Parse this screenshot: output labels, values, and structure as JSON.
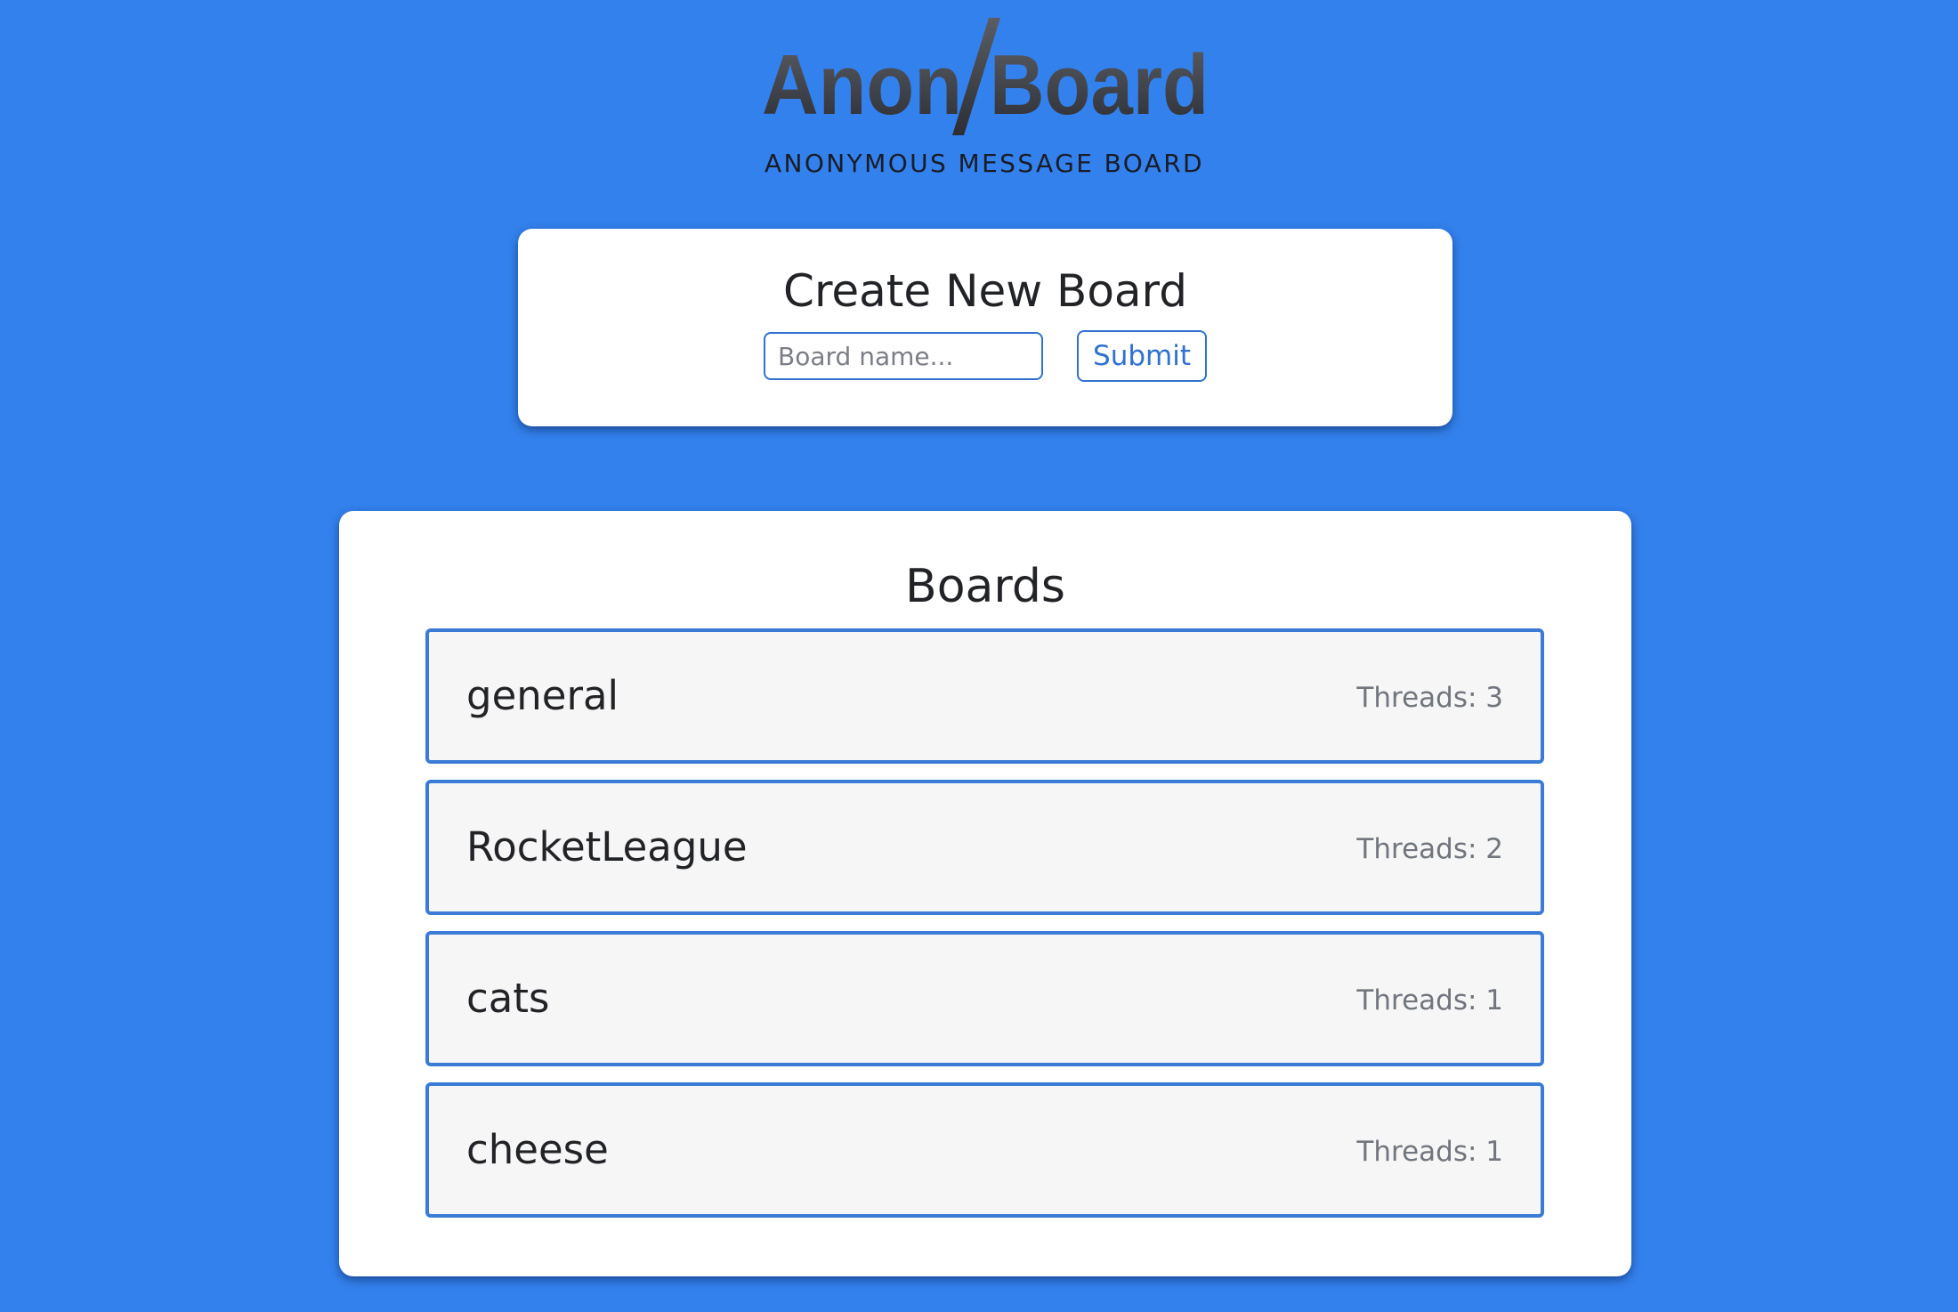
{
  "header": {
    "logo_part1": "Anon",
    "logo_part2": "Board",
    "subtitle": "ANONYMOUS MESSAGE BOARD"
  },
  "create": {
    "title": "Create New Board",
    "input_value": "",
    "input_placeholder": "Board name...",
    "submit_label": "Submit"
  },
  "boards": {
    "title": "Boards",
    "threads_prefix": "Threads: ",
    "items": [
      {
        "name": "general",
        "threads": "Threads: 3"
      },
      {
        "name": "RocketLeague",
        "threads": "Threads: 2"
      },
      {
        "name": "cats",
        "threads": "Threads: 1"
      },
      {
        "name": "cheese",
        "threads": "Threads: 1"
      }
    ]
  },
  "colors": {
    "background": "#3381ec",
    "accent": "#2f72cf",
    "card": "#ffffff",
    "item_background": "#f6f6f6",
    "logo_dark": "#2e3036",
    "logo_light": "#5a5d66"
  }
}
